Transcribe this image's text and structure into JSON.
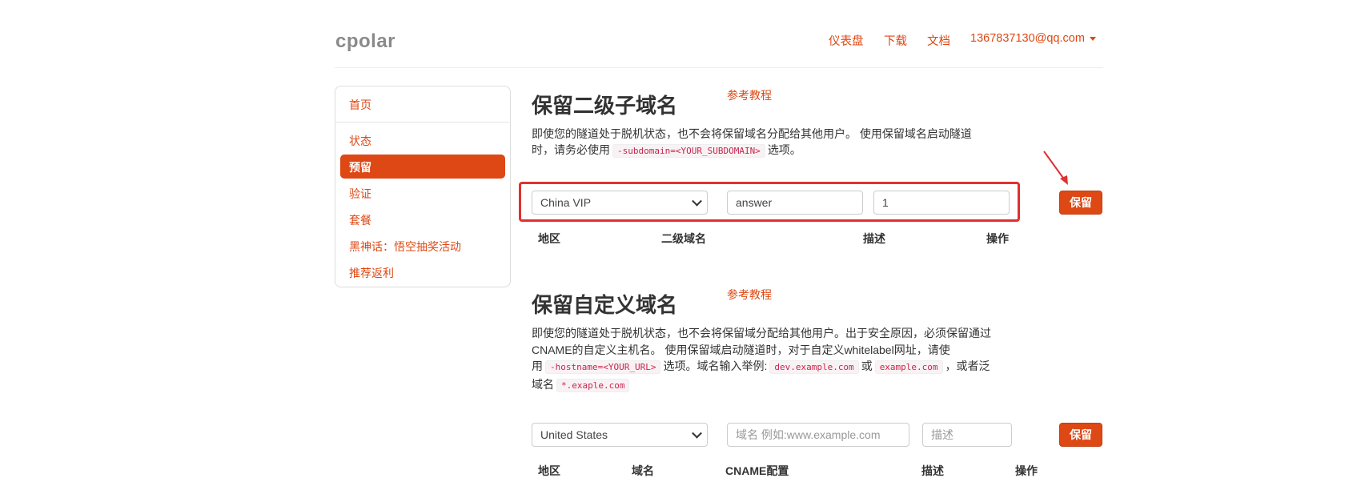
{
  "brand": "cpolar",
  "topnav": {
    "dashboard": "仪表盘",
    "download": "下载",
    "docs": "文档",
    "account": "1367837130@qq.com"
  },
  "sidebar": {
    "items": [
      {
        "label": "首页"
      },
      {
        "label": "状态"
      },
      {
        "label": "预留",
        "active": true
      },
      {
        "label": "验证"
      },
      {
        "label": "套餐"
      },
      {
        "label": "黑神话：悟空抽奖活动"
      },
      {
        "label": "推荐返利"
      }
    ]
  },
  "subdomain": {
    "title": "保留二级子域名",
    "ref_link": "参考教程",
    "desc_line1": "即使您的隧道处于脱机状态，也不会将保留域名分配给其他用户。 使用保留域名启动隧道",
    "desc_line2_pre": "时，请务必使用",
    "desc_code": "-subdomain=<YOUR_SUBDOMAIN>",
    "desc_line2_post": "选项。",
    "region_value": "China VIP",
    "subdomain_value": "answer",
    "description_value": "1",
    "save_label": "保留",
    "headers": [
      "地区",
      "二级域名",
      "描述",
      "操作"
    ]
  },
  "custom": {
    "title": "保留自定义域名",
    "ref_link": "参考教程",
    "desc_line1": "即使您的隧道处于脱机状态，也不会将保留域分配给其他用户。出于安全原因，必须保留通过",
    "desc_line2": "CNAME的自定义主机名。 使用保留域启动隧道时，对于自定义whitelabel网址，请使",
    "desc_line3_pre": "用",
    "desc_code1": "-hostname=<YOUR_URL>",
    "desc_line3_mid": "选项。域名输入举例:",
    "desc_code2": "dev.example.com",
    "desc_line3_or": "或",
    "desc_code3": "example.com",
    "desc_line3_post": "，或者泛",
    "desc_line4_pre": "域名",
    "desc_code4": "*.exaple.com",
    "region_value": "United States",
    "domain_placeholder": "域名 例如:www.example.com",
    "description_placeholder": "描述",
    "save_label": "保留",
    "headers": [
      "地区",
      "域名",
      "CNAME配置",
      "描述",
      "操作"
    ]
  },
  "colors": {
    "accent": "#dd4814",
    "highlight": "#e03030"
  }
}
